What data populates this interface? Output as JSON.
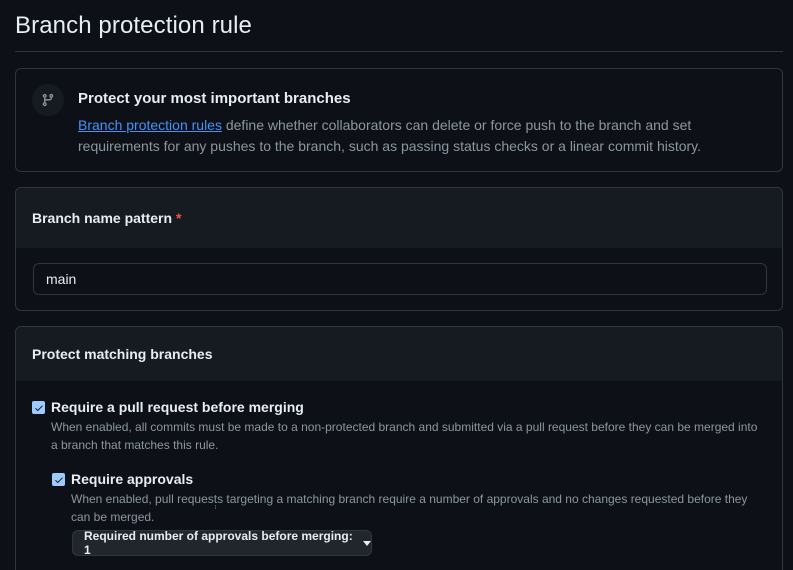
{
  "page": {
    "title": "Branch protection rule"
  },
  "info": {
    "icon": "git-branch-icon",
    "heading": "Protect your most important branches",
    "link_text": "Branch protection rules",
    "text_line1": " define whether collaborators can delete or force push to the branch and set",
    "text_line2": "requirements for any pushes to the branch, such as passing status checks or a linear commit history."
  },
  "branch_pattern": {
    "label": "Branch name pattern",
    "required_mark": "*",
    "value": "main"
  },
  "protect": {
    "header": "Protect matching branches",
    "require_pr": {
      "checked": true,
      "label": "Require a pull request before merging",
      "description_line1": "When enabled, all commits must be made to a non-protected branch and submitted via a pull request before they can be merged into",
      "description_line2": "a branch that matches this rule."
    },
    "require_approvals": {
      "checked": true,
      "label": "Require approvals",
      "description_line1": "When enabled, pull requests targeting a matching branch require a number of approvals and no changes requested before they",
      "description_line2": "can be merged."
    },
    "approvals_select": {
      "label": "Required number of approvals before merging: 1"
    }
  },
  "colors": {
    "background": "#0d1117",
    "panel_header": "#161b22",
    "border": "#30363d",
    "link": "#4493f8",
    "checkbox": "#9ecbff",
    "required": "#f85149"
  }
}
